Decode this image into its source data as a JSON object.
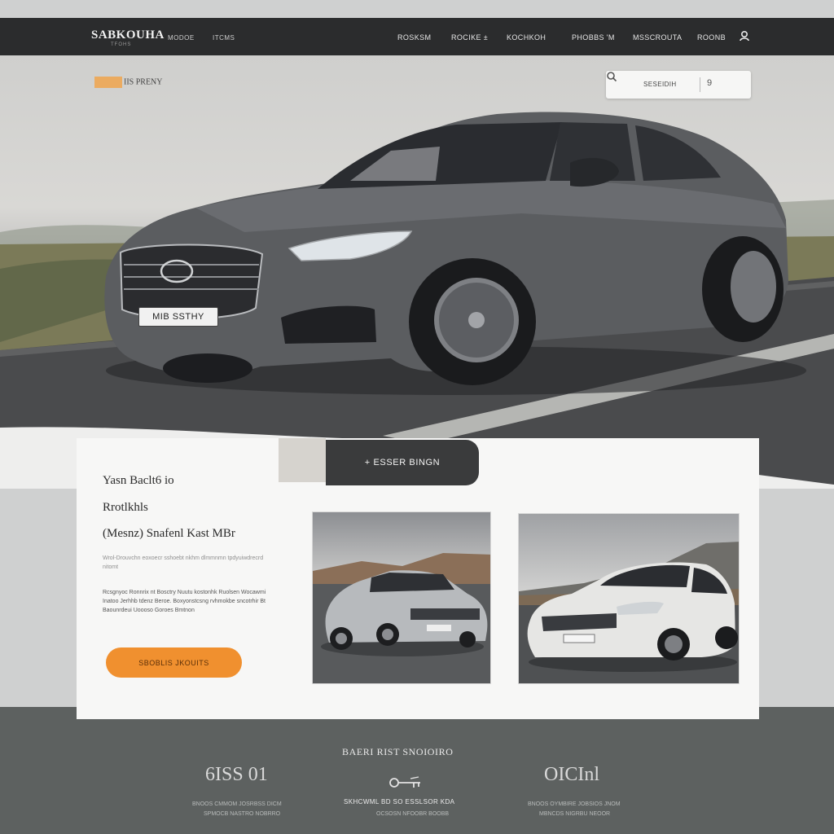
{
  "nav": {
    "brand": "SABKOUHA",
    "brand_sub": "TFOHS",
    "left_links": [
      "MODOE",
      "ITCMS"
    ],
    "links": [
      "ROSKSM",
      "ROCIKE ±",
      "KOCHKOH",
      "PHOBBS 'M",
      "MSSCROUTA",
      "ROONB"
    ],
    "icon": "user-icon"
  },
  "hero": {
    "promo": "IIS PRENY",
    "plate": "MIB  SSTHY",
    "search": {
      "label": "SESEIDIH",
      "number": "9",
      "icon": "search-icon"
    }
  },
  "card": {
    "cta": "+ ESSER BINGN",
    "heading_line1": "Yasn Baclt6 io",
    "heading_line2": "Rrotlkhls",
    "heading_line3": "(Mesnz) Snafenl Kast MBr",
    "para1": "Wrol-Drouvchn eoxoecr sshoebt nkhm dlmmnmn tpdyuiwdrecrd nitomt",
    "para2": "Rcsgnyoc Ronnrix  nt Bosctry Nuutu kostonhk Ruolsen Wocawmi Inatoo Jerhhb tdenz Beroe. Boxyonstcsng rvhmokbe sncotrhir Bt Baounrdeui Uoooso Goroes Bmtnon",
    "button": "SBOBLIS JKOUITS",
    "thumbnails": [
      "silver-hatchback-photo",
      "white-sedan-photo"
    ]
  },
  "footer": {
    "title": "BAERI RIST SNOIOIRO",
    "stat_left": "6ISS 01",
    "stat_right": "OICInl",
    "desc_center": "SKHCWML BD SO ESSLSOR KDA",
    "desc_center_sub": "OCSOSN NFOOBR BOOBB",
    "small_left": "BNOOS CMMOM JOSRBSS DICM",
    "small_left2": "SPMOCB NASTRO NOBRRO",
    "small_right": "BNOOS OYMBIRE JOBSIOS JNOM",
    "small_right2": "MBNCDS NIGRBU NEOOR",
    "icon": "key-icon"
  },
  "colors": {
    "nav_bg": "#2b2c2d",
    "accent_orange": "#f0902f",
    "footer_bg": "#5d6160",
    "card_bg": "#f7f7f6"
  }
}
